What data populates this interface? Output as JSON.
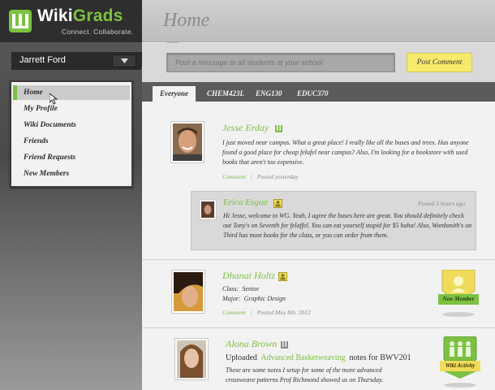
{
  "brand": {
    "name_part1": "Wiki",
    "name_part2": "Grads",
    "tagline": "Connect. Collaborate.",
    "accent": "#7cc142"
  },
  "user": {
    "name": "Jarrett Ford"
  },
  "nav": {
    "items": [
      {
        "label": "Home",
        "active": true
      },
      {
        "label": "My Profile"
      },
      {
        "label": "Wiki Documents"
      },
      {
        "label": "Friends"
      },
      {
        "label": "Friend Requests"
      },
      {
        "label": "New Members"
      }
    ]
  },
  "main": {
    "title": "Home",
    "post_placeholder": "Post a message to all students at your school",
    "post_button": "Post Comment",
    "tabs": [
      {
        "label": "Everyone",
        "active": true
      },
      {
        "label": "CHEM423L"
      },
      {
        "label": "ENG130"
      },
      {
        "label": "EDUC370"
      }
    ]
  },
  "feed": {
    "post1": {
      "author": "Jesse Erday",
      "body": "I just moved near campus. What a great place! I really like all the buses and trees.  Has anyone found a good place for cheap felafel near campus? Also, I'm looking for a bookstore with used books that aren't too expensive.",
      "comment_link": "Comment",
      "posted": "Posted yesterday"
    },
    "reply1": {
      "author": "Erica Esgua",
      "posted": "Posted 5 hours ago",
      "body": "Hi Jesse, welcome to WG.  Yeah, I agree the buses here are great.  You should definitely check out Tony's on Seventh for felaffel. You can eat yourself stupid for $5 haha!  Also, Wordsmith's on Third has most books for the class, or you can order from them."
    },
    "post2": {
      "author": "Dhanai Holtz",
      "class_label": "Class:",
      "class_value": "Senior",
      "major_label": "Major:",
      "major_value": "Graphic Design",
      "comment_link": "Comment",
      "posted": "Posted May 8th. 2012",
      "badge": "New Member"
    },
    "post3": {
      "author": "Alona Brown",
      "uploaded_prefix": "Uploaded",
      "uploaded_link": "Advanced Basketweaving",
      "uploaded_suffix": "notes for BWV201",
      "body": "These are some notes I setup for some of the more advanced crossweave patterns Prof Richmond showed us on Thursday.",
      "badge": "Wiki Activity"
    }
  }
}
